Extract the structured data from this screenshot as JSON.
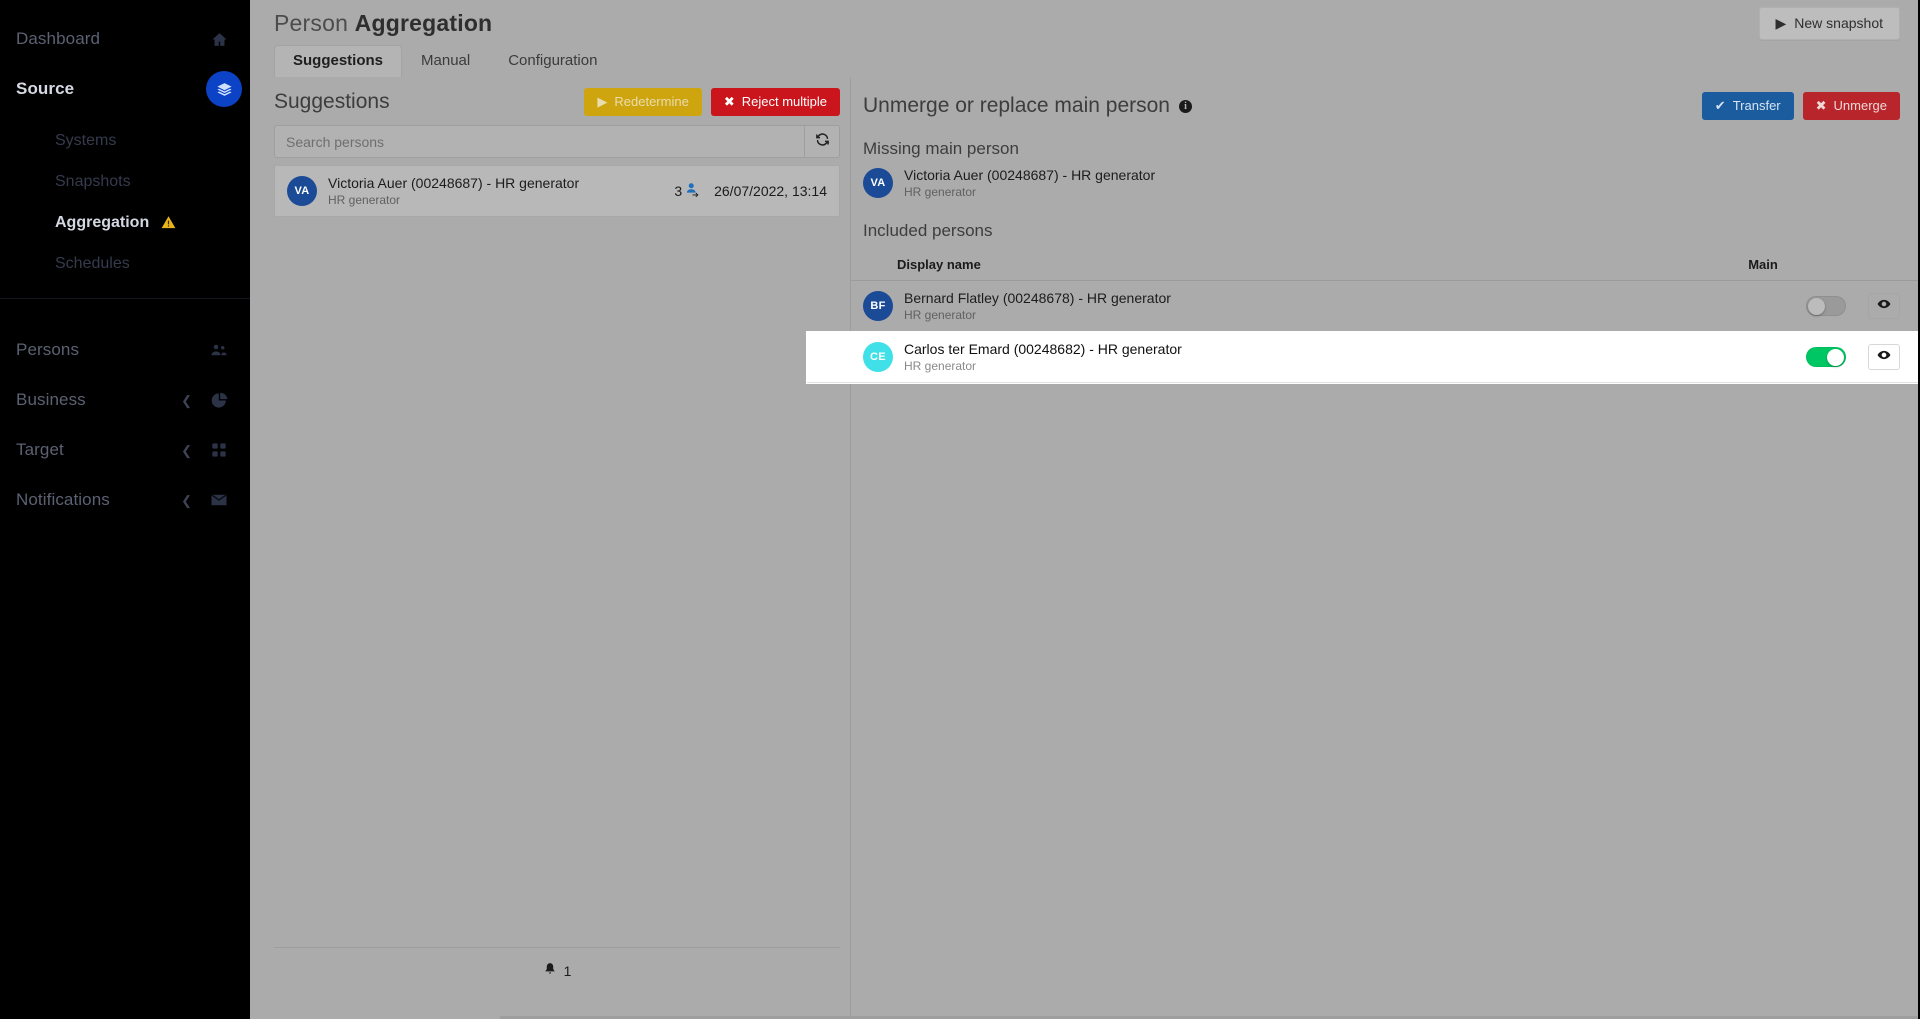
{
  "sidebar": {
    "items": [
      {
        "label": "Dashboard",
        "icon": "home-icon",
        "active": false,
        "expandable": false
      },
      {
        "label": "Source",
        "icon": "layers-icon",
        "active": true,
        "expandable": true
      }
    ],
    "subitems": [
      {
        "label": "Systems",
        "active": false
      },
      {
        "label": "Snapshots",
        "active": false
      },
      {
        "label": "Aggregation",
        "active": true,
        "badge": "warning-icon"
      },
      {
        "label": "Schedules",
        "active": false
      }
    ],
    "items2": [
      {
        "label": "Persons",
        "icon": "people-icon",
        "expandable": false
      },
      {
        "label": "Business",
        "icon": "pie-chart-icon",
        "expandable": true
      },
      {
        "label": "Target",
        "icon": "grid-icon",
        "expandable": true
      },
      {
        "label": "Notifications",
        "icon": "envelope-icon",
        "expandable": true
      }
    ],
    "accent_color": "#0b42c6"
  },
  "header": {
    "title_light": "Person",
    "title_bold": "Aggregation",
    "new_snapshot_label": "New snapshot"
  },
  "tabs": [
    {
      "label": "Suggestions",
      "active": true
    },
    {
      "label": "Manual",
      "active": false
    },
    {
      "label": "Configuration",
      "active": false
    }
  ],
  "suggestions_panel": {
    "title": "Suggestions",
    "redetermine_label": "Redetermine",
    "reject_multiple_label": "Reject multiple",
    "search": {
      "value": "",
      "placeholder": "Search persons"
    },
    "items": [
      {
        "initials": "VA",
        "name": "Victoria Auer (00248687) - HR generator",
        "source": "HR generator",
        "merge_count": "3",
        "date": "26/07/2022, 13:14"
      }
    ],
    "footer_count": "1"
  },
  "detail_panel": {
    "title": "Unmerge or replace main person",
    "info_char": "i",
    "transfer_label": "Transfer",
    "unmerge_label": "Unmerge",
    "missing_main_person_title": "Missing main person",
    "main_person": {
      "initials": "VA",
      "name": "Victoria Auer (00248687) - HR generator",
      "source": "HR generator"
    },
    "included_persons_title": "Included persons",
    "table": {
      "columns": [
        "Display name",
        "Main"
      ],
      "rows": [
        {
          "initials": "BF",
          "avatar_color": "#1b4a96",
          "name": "Bernard Flatley (00248678) - HR generator",
          "source": "HR generator",
          "main": false,
          "highlighted": false
        },
        {
          "initials": "CE",
          "avatar_color": "#3fe0e8",
          "name": "Carlos ter Emard (00248682) - HR generator",
          "source": "HR generator",
          "main": true,
          "highlighted": true
        }
      ]
    }
  },
  "colors": {
    "overlay_background": "#ababab",
    "sidebar_background": "#000000",
    "accent_blue": "#0b42c6",
    "danger_red": "#c9151b",
    "warning_yellow": "#cfa50f",
    "toggle_on_green": "#00c763",
    "highlight_row": "#ffffff"
  }
}
